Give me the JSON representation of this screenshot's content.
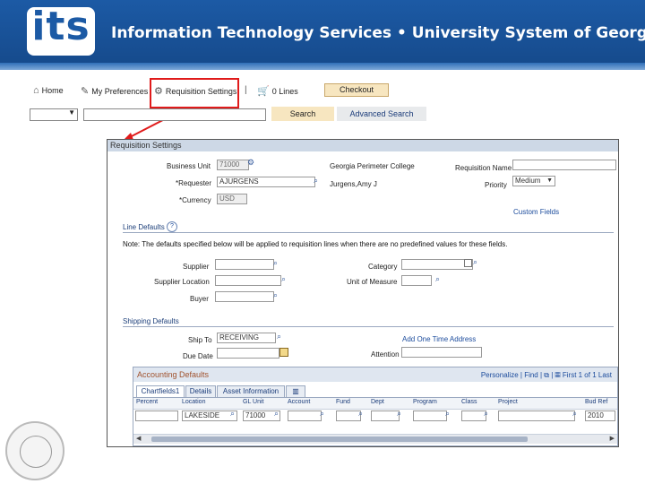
{
  "banner": {
    "logo": "its",
    "title": "Information Technology Services  •  University System of Georgia"
  },
  "nav": {
    "home": "Home",
    "preferences": "My Preferences",
    "settings": "Requisition Settings",
    "lines": "0 Lines",
    "checkout": "Checkout"
  },
  "search": {
    "button": "Search",
    "advanced": "Advanced Search"
  },
  "panel": {
    "title": "Requisition Settings",
    "business_unit_label": "Business Unit",
    "business_unit_value": "71000",
    "business_unit_name": "Georgia Perimeter College",
    "requester_label": "*Requester",
    "requester_value": "AJURGENS",
    "requester_name": "Jurgens,Amy J",
    "currency_label": "*Currency",
    "currency_value": "USD",
    "req_name_label": "Requisition Name",
    "priority_label": "Priority",
    "priority_value": "Medium",
    "custom_fields": "Custom Fields",
    "line_defaults": "Line Defaults",
    "help_icon": "?",
    "note": "Note: The defaults specified below will be applied to requisition lines when there are no predefined values for these fields.",
    "supplier_label": "Supplier",
    "supplier_location_label": "Supplier Location",
    "buyer_label": "Buyer",
    "category_label": "Category",
    "uom_label": "Unit of Measure",
    "shipping_defaults": "Shipping Defaults",
    "ship_to_label": "Ship To",
    "ship_to_value": "RECEIVING",
    "add_address": "Add One Time Address",
    "due_date_label": "Due Date",
    "attention_label": "Attention"
  },
  "accounting": {
    "title": "Accounting Defaults",
    "tools": [
      "Personalize",
      "Find"
    ],
    "pagination": "First  1 of 1  Last",
    "tabs": [
      "Chartfields1",
      "Details",
      "Asset Information"
    ],
    "columns": [
      "Percent",
      "Location",
      "GL Unit",
      "Account",
      "Fund",
      "Dept",
      "Program",
      "Class",
      "Project",
      "Bud Ref"
    ],
    "row": {
      "location": "LAKESIDE",
      "gl_unit": "71000",
      "bud_ref": "2010"
    }
  }
}
